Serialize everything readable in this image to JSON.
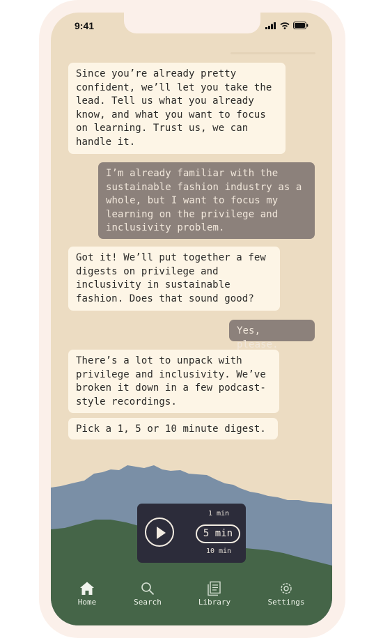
{
  "status_bar": {
    "time": "9:41"
  },
  "messages": [
    {
      "from": "bot",
      "text": "Since you’re already pretty\nconfident, we’ll let you take the\nlead. Tell us what you already\nknow, and what you want to focus\non learning. Trust us, we can\nhandle it."
    },
    {
      "from": "user",
      "text": "I’m already familiar with the\nsustainable fashion industry as a\nwhole, but I want to focus my\nlearning on the privilege and\ninclusivity problem."
    },
    {
      "from": "bot",
      "text": "Got it! We’ll put together a few\ndigests on privilege and\ninclusivity in sustainable\nfashion. Does that sound good?"
    },
    {
      "from": "user",
      "text": "Yes, please."
    },
    {
      "from": "bot",
      "text": "There’s a lot to unpack with\nprivilege and inclusivity. We’ve\nbroken it down in a few podcast-\nstyle recordings."
    },
    {
      "from": "bot",
      "text": "Pick a 1, 5 or 10 minute digest."
    }
  ],
  "player": {
    "options": [
      "1 min",
      "5 min",
      "10 min"
    ],
    "selected": "5 min"
  },
  "nav": [
    {
      "label": "Home",
      "icon": "home-icon",
      "active": true
    },
    {
      "label": "Search",
      "icon": "search-icon",
      "active": false
    },
    {
      "label": "Library",
      "icon": "library-icon",
      "active": false
    },
    {
      "label": "Settings",
      "icon": "gear-icon",
      "active": false
    }
  ],
  "colors": {
    "screen_bg": "#ecdcc2",
    "bot_bubble": "#fdf5e6",
    "user_bubble": "#8c817b",
    "hill_blue": "#7a8fa6",
    "hill_green": "#456548",
    "player_bg": "#2c2c3a"
  }
}
